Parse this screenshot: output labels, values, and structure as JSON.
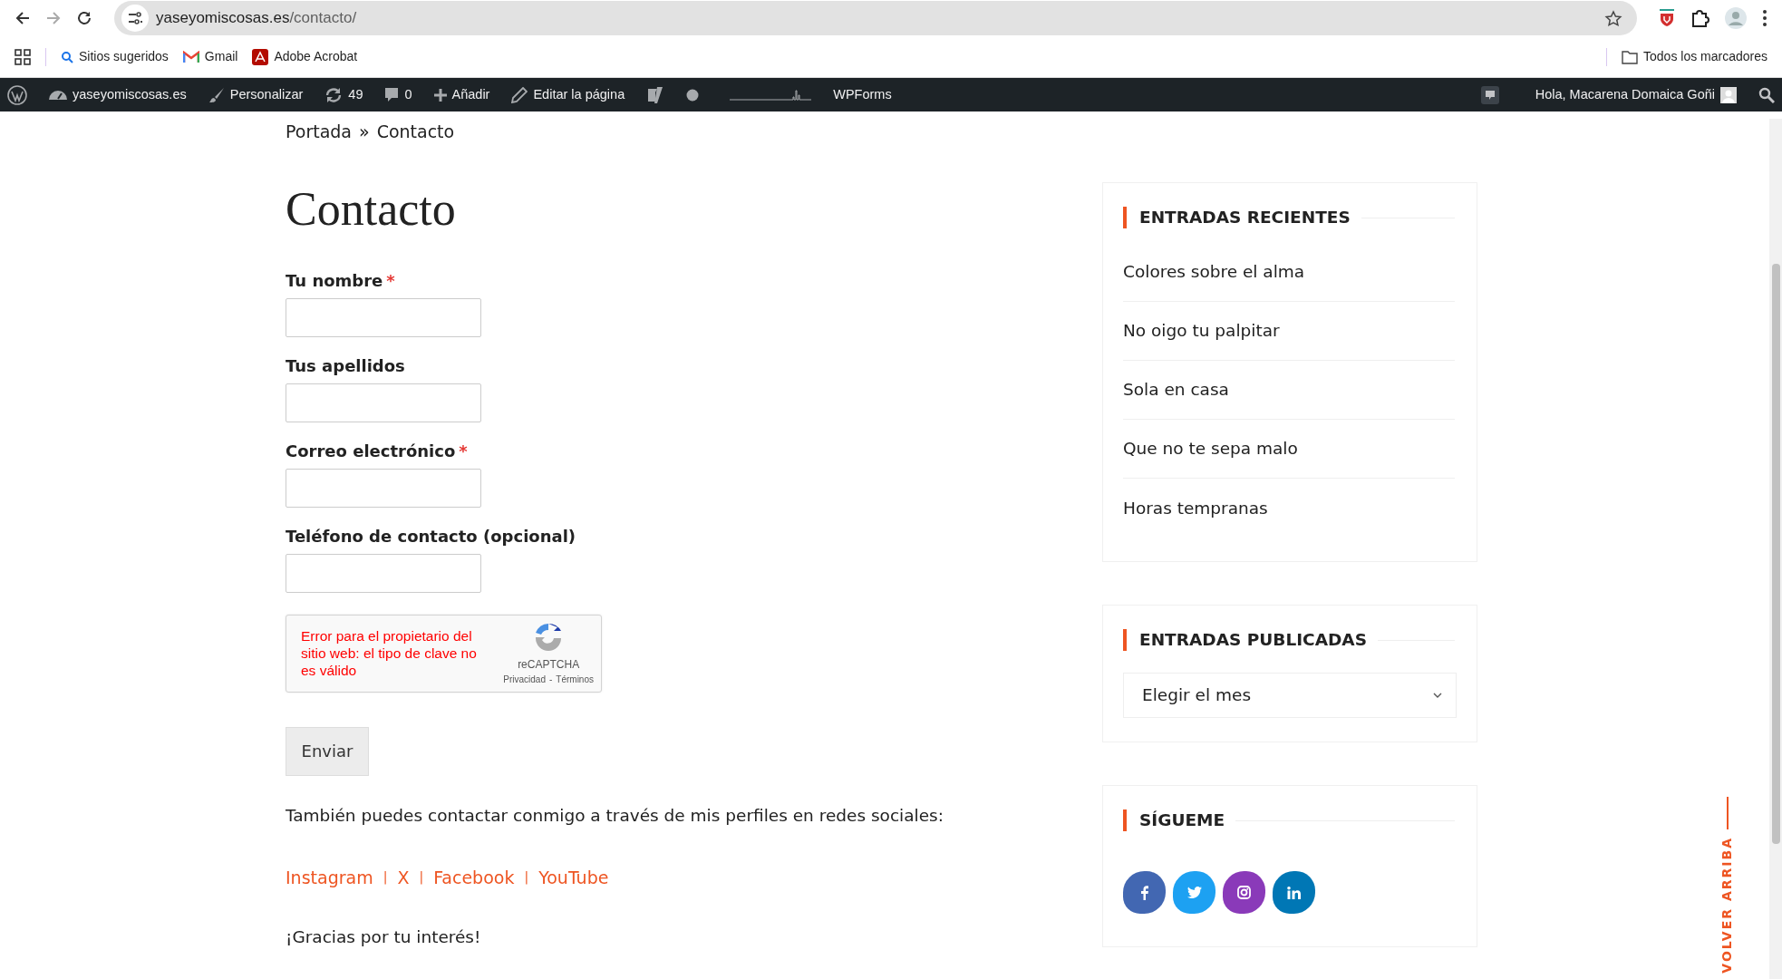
{
  "browser": {
    "url_domain": "yaseyomiscosas.es",
    "url_path": "/contacto/",
    "bookmarks": [
      {
        "kind": "search",
        "label": "Sitios sugeridos"
      },
      {
        "kind": "gmail",
        "label": "Gmail"
      },
      {
        "kind": "acrobat",
        "label": "Adobe Acrobat"
      }
    ],
    "all_bookmarks": "Todos los marcadores"
  },
  "admin_bar": {
    "site": "yaseyomiscosas.es",
    "customize": "Personalizar",
    "updates": "49",
    "comments": "0",
    "add": "Añadir",
    "edit": "Editar la página",
    "forms": "WPForms",
    "greeting": "Hola, Macarena Domaica Goñi"
  },
  "breadcrumb": {
    "home": "Portada",
    "separator": "»",
    "current": "Contacto"
  },
  "title": "Contacto",
  "fields": [
    {
      "label": "Tu nombre",
      "required_mark": "*"
    },
    {
      "label": "Tus apellidos"
    },
    {
      "label": "Correo electrónico",
      "required_mark": "*"
    },
    {
      "label": "Teléfono de contacto (opcional)"
    }
  ],
  "recaptcha": {
    "error": "Error para el propietario del sitio web: el tipo de clave no es válido",
    "brand": "reCAPTCHA",
    "privacy": "Privacidad",
    "dash": "-",
    "terms": "Términos"
  },
  "submit": "Enviar",
  "social_text": "También puedes contactar conmigo a través de mis perfiles en redes sociales:",
  "social_links": [
    {
      "kind": "link",
      "label": "Instagram"
    },
    {
      "kind": "sep",
      "label": "|"
    },
    {
      "kind": "link",
      "label": "X"
    },
    {
      "kind": "sep",
      "label": "|"
    },
    {
      "kind": "link",
      "label": "Facebook"
    },
    {
      "kind": "sep",
      "label": "|"
    },
    {
      "kind": "link",
      "label": "YouTube"
    }
  ],
  "thanks": "¡Gracias por tu interés!",
  "sidebar": {
    "recent": {
      "title": "ENTRADAS RECIENTES",
      "items": [
        "Colores sobre el alma",
        "No oigo tu palpitar",
        "Sola en casa",
        "Que no te sepa malo",
        "Horas tempranas"
      ]
    },
    "archive": {
      "title": "ENTRADAS PUBLICADAS",
      "placeholder": "Elegir el mes"
    },
    "follow": {
      "title": "SÍGUEME",
      "icons": [
        {
          "kind": "facebook",
          "color": "#4267b2"
        },
        {
          "kind": "twitter",
          "color": "#1da1f2"
        },
        {
          "kind": "instagram",
          "color": "#8a3ab9"
        },
        {
          "kind": "linkedin",
          "color": "#0077b5"
        }
      ]
    }
  },
  "back_to_top": "VOLVER ARRIBA"
}
